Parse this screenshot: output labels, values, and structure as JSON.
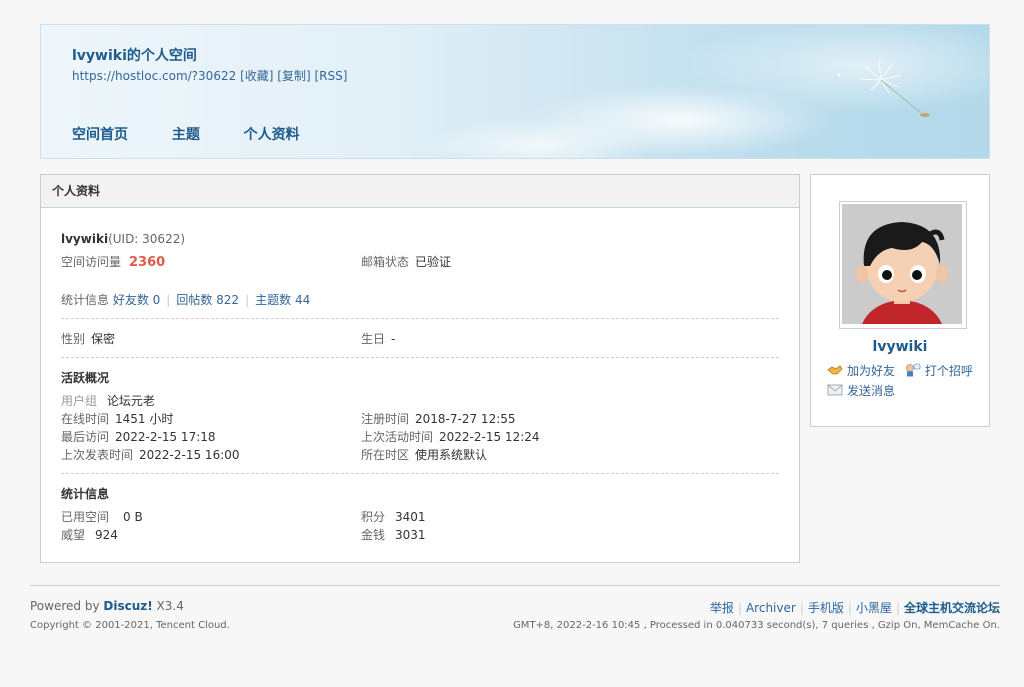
{
  "header": {
    "title": "lvywiki的个人空间",
    "url": "https://hostloc.com/?30622",
    "actions": [
      "[收藏]",
      "[复制]",
      "[RSS]"
    ],
    "nav": [
      "空间首页",
      "主题",
      "个人资料"
    ]
  },
  "profile": {
    "panel_title": "个人资料",
    "username": "lvywiki",
    "uid_text": "(UID: 30622)",
    "visits_label": "空间访问量",
    "visits_value": "2360",
    "email_label": "邮箱状态",
    "email_value": "已验证",
    "stats_label": "统计信息",
    "friends_link": "好友数 0",
    "replies_link": "回帖数 822",
    "threads_link": "主题数 44",
    "gender_label": "性别",
    "gender_value": "保密",
    "birthday_label": "生日",
    "birthday_value": "-",
    "activity_title": "活跃概况",
    "group_label": "用户组",
    "group_value": "论坛元老",
    "online_label": "在线时间",
    "online_value": "1451 小时",
    "register_label": "注册时间",
    "register_value": "2018-7-27 12:55",
    "lastvisit_label": "最后访问",
    "lastvisit_value": "2022-2-15 17:18",
    "lastactive_label": "上次活动时间",
    "lastactive_value": "2022-2-15 12:24",
    "lastpost_label": "上次发表时间",
    "lastpost_value": "2022-2-15 16:00",
    "timezone_label": "所在时区",
    "timezone_value": "使用系统默认",
    "stat_title": "统计信息",
    "space_label": "已用空间",
    "space_value": "0 B",
    "credits_label": "积分",
    "credits_value": "3401",
    "prestige_label": "威望",
    "prestige_value": "924",
    "money_label": "金钱",
    "money_value": "3031"
  },
  "card": {
    "name": "lvywiki",
    "add_friend": "加为好友",
    "greet": "打个招呼",
    "send_message": "发送消息"
  },
  "footer": {
    "powered_prefix": "Powered by ",
    "powered_brand": "Discuz!",
    "powered_version": " X3.4",
    "copyright": "Copyright © 2001-2021, Tencent Cloud.",
    "links": [
      "举报",
      "Archiver",
      "手机版",
      "小黑屋"
    ],
    "site_name": "全球主机交流论坛",
    "stats": "GMT+8, 2022-2-16 10:45 , Processed in 0.040733 second(s), 7 queries , Gzip On, MemCache On."
  }
}
